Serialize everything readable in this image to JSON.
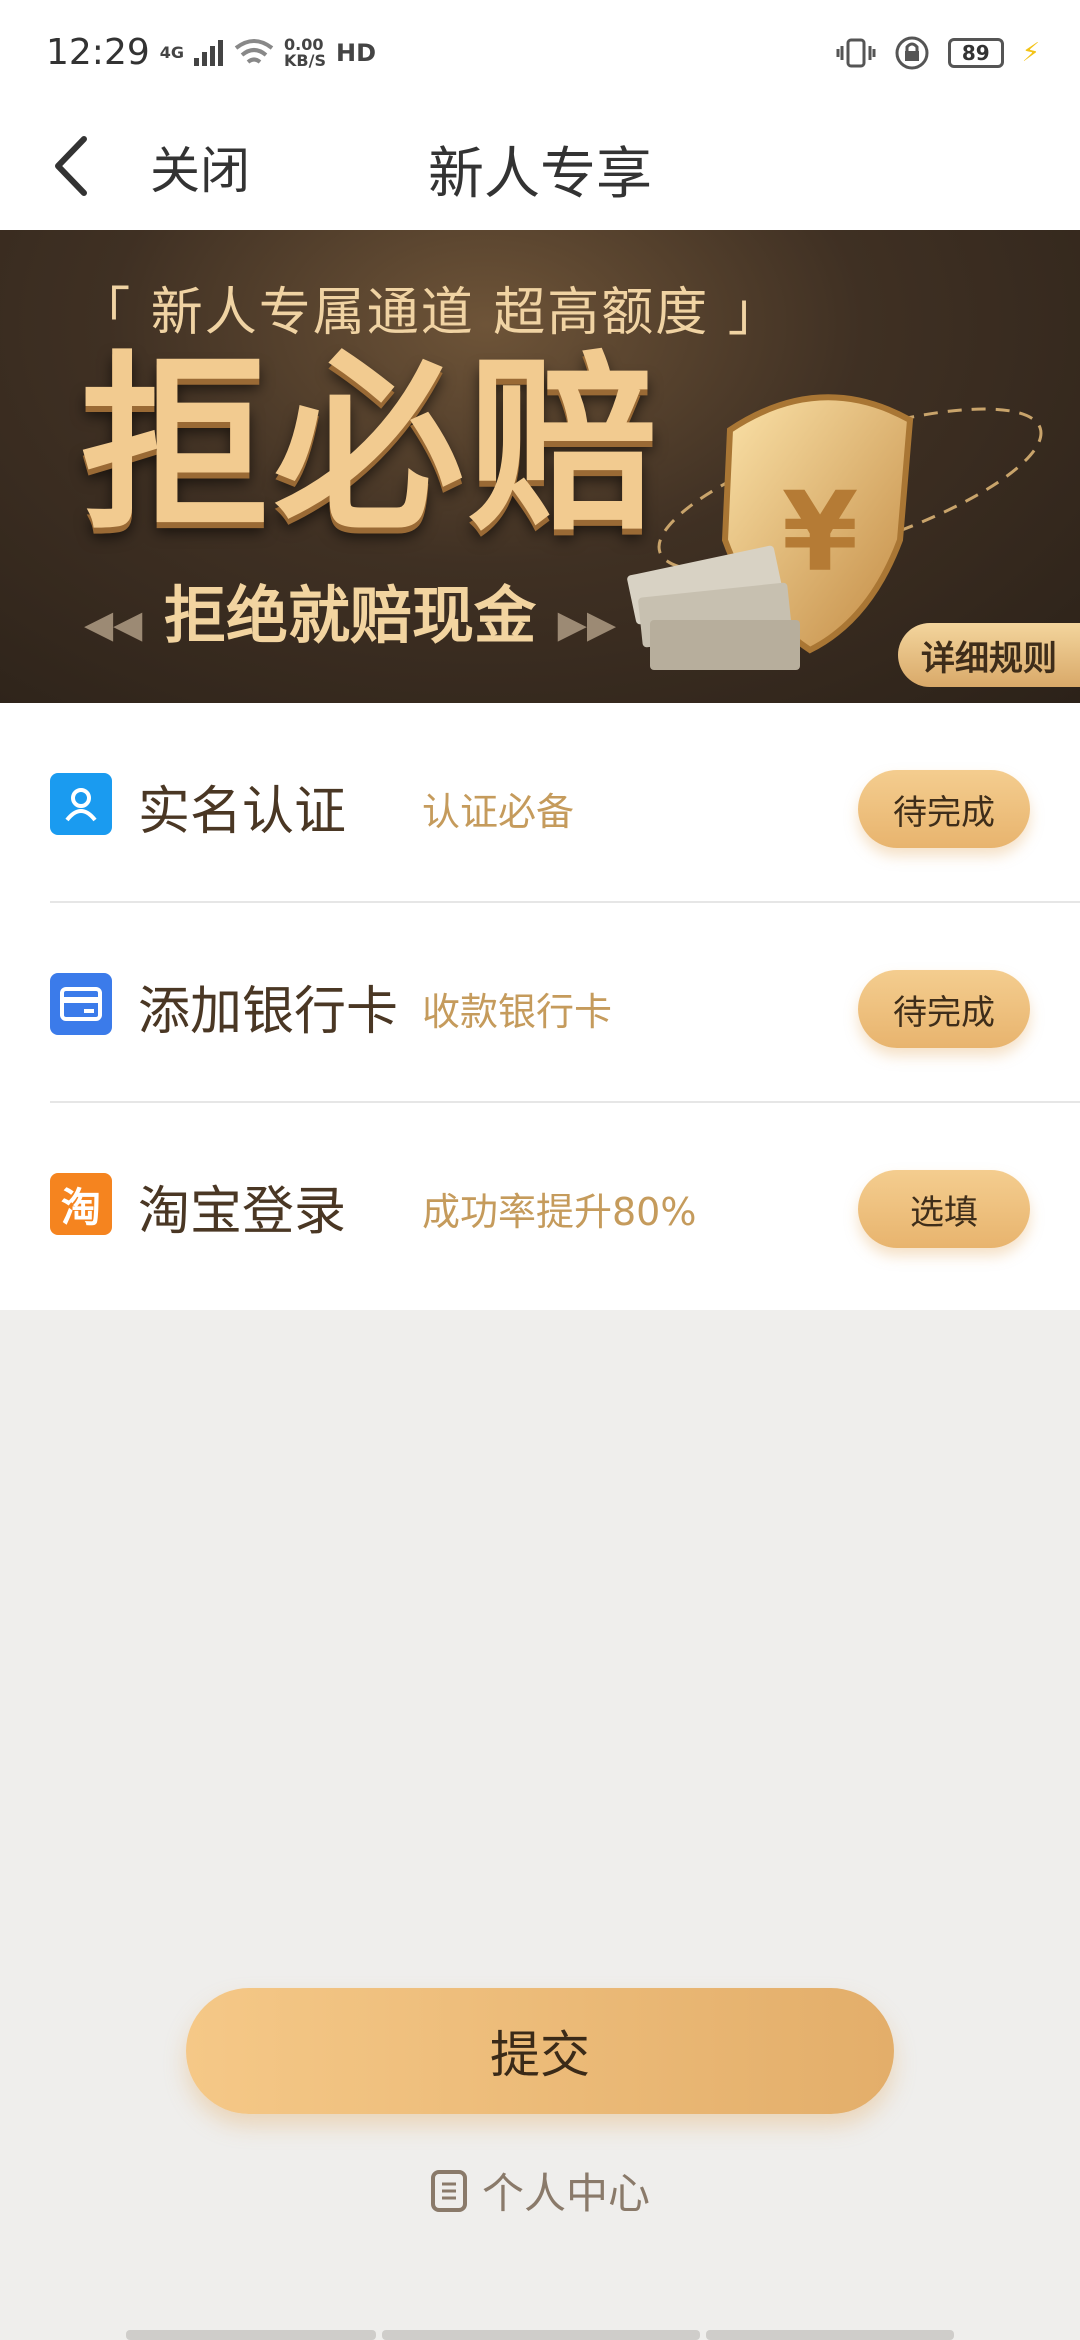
{
  "status_bar": {
    "time": "12:29",
    "network": "4G",
    "speed_value": "0.00",
    "speed_unit": "KB/S",
    "hd": "HD",
    "battery": "89"
  },
  "nav": {
    "close_label": "关闭",
    "title": "新人专享"
  },
  "banner": {
    "subtitle": "「 新人专属通道  超高额度 」",
    "title": "拒必赔",
    "slogan": "拒绝就赔现金",
    "rules_label": "详细规则"
  },
  "tasks": [
    {
      "name": "实名认证",
      "desc": "认证必备",
      "button": "待完成",
      "icon": "user-icon",
      "color": "#1a9bf0"
    },
    {
      "name": "添加银行卡",
      "desc": "收款银行卡",
      "button": "待完成",
      "icon": "bank-card-icon",
      "color": "#3b7bea"
    },
    {
      "name": "淘宝登录",
      "desc": "成功率提升80%",
      "button": "选填",
      "icon": "taobao-icon",
      "icon_char": "淘",
      "color": "#f5841f"
    }
  ],
  "submit_label": "提交",
  "personal_center_label": "个人中心"
}
